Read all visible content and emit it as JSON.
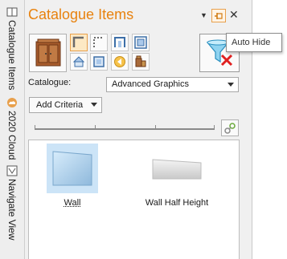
{
  "vertical_tabs": [
    {
      "label": "Catalogue Items",
      "icon": "book-icon"
    },
    {
      "label": "2020 Cloud",
      "icon": "cloud-icon"
    },
    {
      "label": "Navigate View",
      "icon": "navigate-icon"
    }
  ],
  "panel": {
    "title": "Catalogue Items",
    "catalogue_label": "Catalogue:",
    "catalogue_value": "Advanced Graphics",
    "criteria_label": "Add Criteria"
  },
  "tooltip": {
    "text": "Auto Hide"
  },
  "items": [
    {
      "label": "Wall",
      "selected": true
    },
    {
      "label": "Wall Half Height",
      "selected": false
    }
  ],
  "colors": {
    "accent": "#e8820e",
    "selection": "#cce4f7",
    "pin_border": "#e8a04c"
  }
}
